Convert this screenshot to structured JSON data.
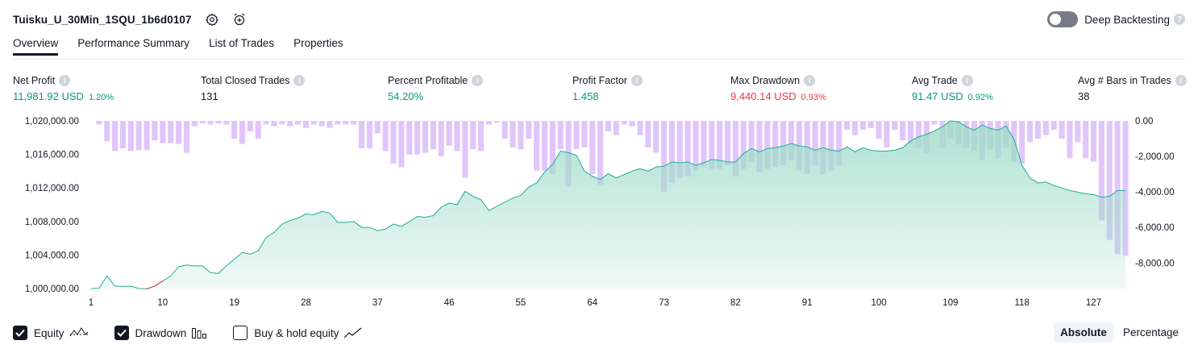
{
  "header": {
    "title": "Tuisku_U_30Min_1SQU_1b6d0107",
    "icons": [
      "settings-icon",
      "alarm-add-icon"
    ]
  },
  "deep_backtesting": {
    "label": "Deep Backtesting",
    "enabled": false
  },
  "tabs": [
    {
      "label": "Overview",
      "active": true
    },
    {
      "label": "Performance Summary",
      "active": false
    },
    {
      "label": "List of Trades",
      "active": false
    },
    {
      "label": "Properties",
      "active": false
    }
  ],
  "metrics": {
    "net_profit": {
      "label": "Net Profit",
      "value": "11,981.92 USD",
      "pct": "1.20%"
    },
    "total_closed_trades": {
      "label": "Total Closed Trades",
      "value": "131"
    },
    "percent_profitable": {
      "label": "Percent Profitable",
      "value": "54.20%"
    },
    "profit_factor": {
      "label": "Profit Factor",
      "value": "1.458"
    },
    "max_drawdown": {
      "label": "Max Drawdown",
      "value": "9,440.14 USD",
      "pct": "0.93%"
    },
    "avg_trade": {
      "label": "Avg Trade",
      "value": "91.47 USD",
      "pct": "0.92%"
    },
    "avg_bars": {
      "label": "Avg # Bars in Trades",
      "value": "38"
    }
  },
  "colors": {
    "equity_line": "#22ab94",
    "equity_fill": "#b9e6dc",
    "equity_negative": "#f23645",
    "drawdown_bar": "#e1c6fb",
    "profit": "#089981",
    "loss": "#f23645"
  },
  "chart_data": {
    "type": "area",
    "x_ticks": [
      "1",
      "10",
      "19",
      "28",
      "37",
      "46",
      "55",
      "64",
      "73",
      "82",
      "91",
      "100",
      "109",
      "118",
      "127"
    ],
    "y_left_ticks": [
      "1,020,000.00",
      "1,016,000.00",
      "1,012,000.00",
      "1,008,000.00",
      "1,004,000.00",
      "1,000,000.00"
    ],
    "y_left_lim": [
      1000000,
      1020000
    ],
    "y_right_ticks": [
      "0.00",
      "-2,000.00",
      "-4,000.00",
      "-6,000.00",
      "-8,000.00"
    ],
    "y_right_lim": [
      -9440,
      0
    ],
    "trade_count": 131,
    "series": [
      {
        "name": "Equity",
        "values": [
          1000000,
          1000020,
          1001500,
          1000300,
          1000250,
          1000280,
          1000000,
          999950,
          1000300,
          1000900,
          1001500,
          1002600,
          1002800,
          1002700,
          1002700,
          1001900,
          1001800,
          1002700,
          1003500,
          1004300,
          1004100,
          1004500,
          1006100,
          1006700,
          1007700,
          1008100,
          1008400,
          1008900,
          1008800,
          1009200,
          1009000,
          1007900,
          1007900,
          1008000,
          1007300,
          1007300,
          1006900,
          1007100,
          1007700,
          1007400,
          1008000,
          1008600,
          1008500,
          1008700,
          1009700,
          1010200,
          1010000,
          1011600,
          1011000,
          1010600,
          1009300,
          1009800,
          1010300,
          1010800,
          1011100,
          1012100,
          1012600,
          1013900,
          1014800,
          1016400,
          1016200,
          1015900,
          1014000,
          1013400,
          1013000,
          1013700,
          1013200,
          1013600,
          1014000,
          1014300,
          1014000,
          1014500,
          1014600,
          1015100,
          1015000,
          1015100,
          1014700,
          1015000,
          1015400,
          1015300,
          1015100,
          1015100,
          1016100,
          1016700,
          1016300,
          1016700,
          1016800,
          1017000,
          1017300,
          1017000,
          1016900,
          1016500,
          1016800,
          1016500,
          1016400,
          1016900,
          1016300,
          1016800,
          1016500,
          1016400,
          1016400,
          1016500,
          1016800,
          1017600,
          1018100,
          1018400,
          1018800,
          1019300,
          1020000,
          1019900,
          1019300,
          1018900,
          1019500,
          1019100,
          1018900,
          1019400,
          1017800,
          1014700,
          1013200,
          1012600,
          1012700,
          1012300,
          1012000,
          1011700,
          1011500,
          1011300,
          1011200,
          1010900,
          1011000,
          1011700,
          1011700
        ]
      },
      {
        "name": "Drawdown",
        "values": [
          0,
          -200,
          -1150,
          -1700,
          -1550,
          -1700,
          -1650,
          -1650,
          -1100,
          -1250,
          -1250,
          -1300,
          -1800,
          -300,
          -150,
          -200,
          -150,
          -200,
          -1000,
          -1300,
          -600,
          -1000,
          -200,
          -300,
          -200,
          -300,
          -200,
          -400,
          -200,
          -300,
          -400,
          -200,
          -200,
          -200,
          -1550,
          -1550,
          -700,
          -1700,
          -2400,
          -2600,
          -1900,
          -1900,
          -1800,
          -1600,
          -2000,
          -1400,
          -1700,
          -3200,
          -1600,
          -1700,
          -200,
          -100,
          -1000,
          -1500,
          -1600,
          -1000,
          -2800,
          -2800,
          -3000,
          -1600,
          -3700,
          -1600,
          -1500,
          -3000,
          -3600,
          -600,
          -800,
          -200,
          -300,
          -800,
          -1500,
          -1800,
          -4000,
          -3500,
          -3200,
          -3100,
          -2800,
          -2600,
          -2700,
          -2700,
          -2500,
          -3100,
          -2700,
          -2300,
          -2900,
          -2700,
          -2600,
          -2500,
          -2200,
          -2800,
          -3000,
          -2500,
          -3000,
          -2800,
          -2500,
          -500,
          -800,
          -500,
          -400,
          -1000,
          -1500,
          -500,
          -1100,
          -1300,
          -1500,
          -1800,
          -200,
          -1500,
          -1000,
          -1300,
          -1500,
          -1700,
          -2200,
          -1600,
          -2100,
          -1500,
          -2300,
          -2400,
          -1200,
          -1000,
          -800,
          -500,
          -1000,
          -2100,
          -1200,
          -2100,
          -2300,
          -5600,
          -6700,
          -7500,
          -7600,
          -7400,
          -7600,
          -7700,
          -8400,
          -8200,
          -8800,
          -9400,
          -9200,
          -9300,
          -9400,
          -9100,
          -8900,
          -7800
        ]
      }
    ],
    "negative_range": [
      7,
      9
    ]
  },
  "footer": {
    "checkboxes": [
      {
        "label": "Equity",
        "checked": true,
        "icon": "equity-line-icon"
      },
      {
        "label": "Drawdown",
        "checked": true,
        "icon": "drawdown-bars-icon"
      },
      {
        "label": "Buy & hold equity",
        "checked": false,
        "icon": "buy-hold-line-icon"
      }
    ],
    "modes": [
      {
        "label": "Absolute",
        "active": true
      },
      {
        "label": "Percentage",
        "active": false
      }
    ]
  }
}
